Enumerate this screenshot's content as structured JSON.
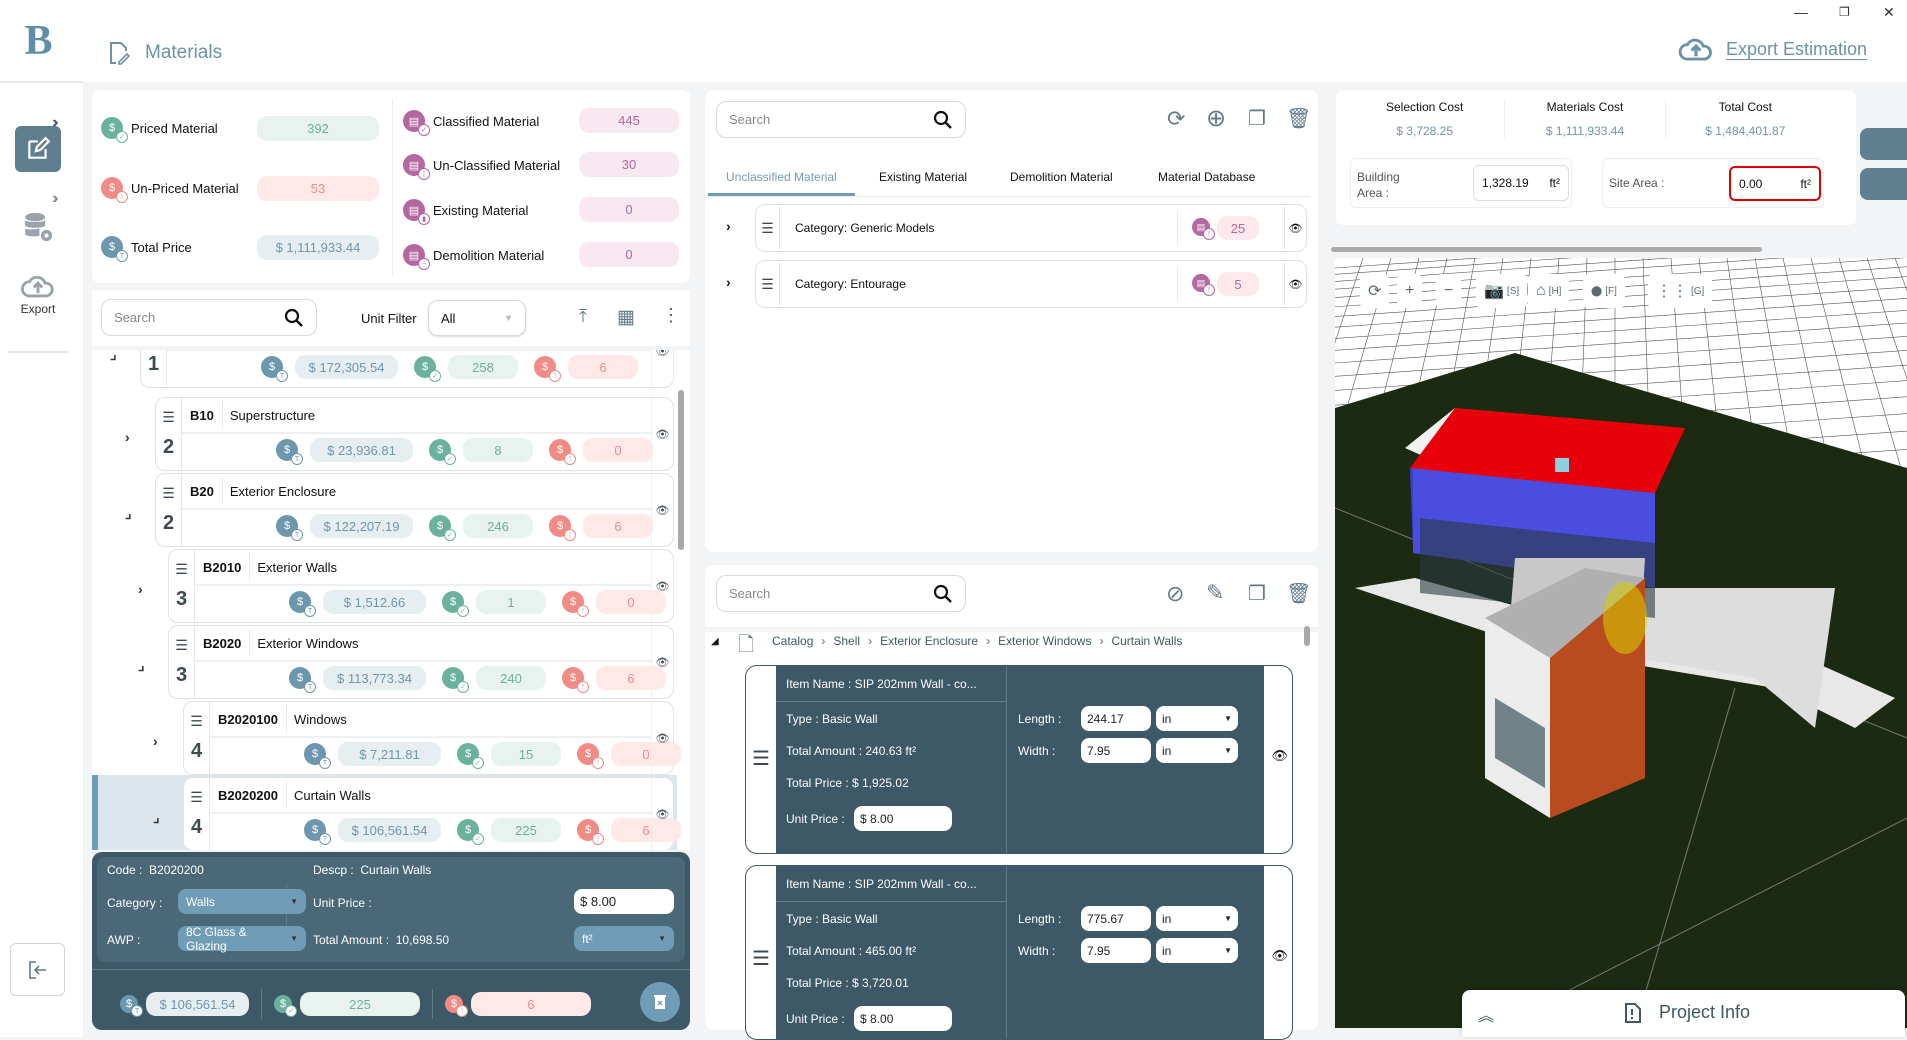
{
  "app": {
    "title": "Materials"
  },
  "window_controls": {
    "minimize": "—",
    "maximize": "❐",
    "close": "✕"
  },
  "sidebar": {
    "logo": "B",
    "items": [
      {
        "name": "materials",
        "icon": "edit-icon",
        "active": true
      },
      {
        "name": "database-settings",
        "icon": "database-gear-icon",
        "active": false
      },
      {
        "name": "export",
        "icon": "cloud-upload-icon",
        "label": "Export"
      }
    ],
    "logout_icon": "logout-icon"
  },
  "header": {
    "export_label": "Export Estimation"
  },
  "stats": {
    "priced": {
      "label": "Priced Material",
      "value": "392"
    },
    "unpriced": {
      "label": "Un-Priced Material",
      "value": "53"
    },
    "total": {
      "label": "Total Price",
      "value": "$ 1,111,933.44"
    },
    "classified": {
      "label": "Classified Material",
      "value": "445"
    },
    "unclassified": {
      "label": "Un-Classified Material",
      "value": "30"
    },
    "existing": {
      "label": "Existing Material",
      "value": "0"
    },
    "demolition": {
      "label": "Demolition Material",
      "value": "0"
    }
  },
  "filter": {
    "search_placeholder": "Search",
    "unit_filter_label": "Unit Filter",
    "unit_filter_value": "All"
  },
  "tree": {
    "rows": [
      {
        "level": "1",
        "code": "",
        "desc": "",
        "total": "$ 172,305.54",
        "priced": "258",
        "unpriced": "6",
        "expanded": true,
        "selected": false
      },
      {
        "level": "2",
        "code": "B10",
        "desc": "Superstructure",
        "total": "$ 23,936.81",
        "priced": "8",
        "unpriced": "0",
        "expanded": false,
        "selected": false
      },
      {
        "level": "2",
        "code": "B20",
        "desc": "Exterior Enclosure",
        "total": "$ 122,207.19",
        "priced": "246",
        "unpriced": "6",
        "expanded": true,
        "selected": false
      },
      {
        "level": "3",
        "code": "B2010",
        "desc": "Exterior Walls",
        "total": "$ 1,512.66",
        "priced": "1",
        "unpriced": "0",
        "expanded": false,
        "selected": false
      },
      {
        "level": "3",
        "code": "B2020",
        "desc": "Exterior Windows",
        "total": "$ 113,773.34",
        "priced": "240",
        "unpriced": "6",
        "expanded": true,
        "selected": false
      },
      {
        "level": "4",
        "code": "B2020100",
        "desc": "Windows",
        "total": "$ 7,211.81",
        "priced": "15",
        "unpriced": "0",
        "expanded": false,
        "selected": false
      },
      {
        "level": "4",
        "code": "B2020200",
        "desc": "Curtain Walls",
        "total": "$ 106,561.54",
        "priced": "225",
        "unpriced": "6",
        "expanded": true,
        "selected": true
      }
    ]
  },
  "detail": {
    "code_label": "Code :",
    "code": "B2020200",
    "descp_label": "Descp :",
    "descp": "Curtain Walls",
    "category_label": "Category :",
    "category": "Walls",
    "awp_label": "AWP :",
    "awp": "8C  Glass & Glazing",
    "unit_price_label": "Unit Price :",
    "unit_price": "$ 8.00",
    "total_amount_label": "Total Amount :",
    "total_amount": "10,698.50",
    "unit": "ft²",
    "total": "$ 106,561.54",
    "priced": "225",
    "unpriced": "6"
  },
  "middle": {
    "search_placeholder": "Search",
    "tabs": [
      "Unclassified Material",
      "Existing Material",
      "Demolition Material",
      "Material Database"
    ],
    "active_tab": 0,
    "categories": [
      {
        "label": "Category:  Generic Models",
        "count": "25"
      },
      {
        "label": "Category:  Entourage",
        "count": "5"
      }
    ],
    "bottom_search_placeholder": "Search",
    "breadcrumb": [
      "Catalog",
      "Shell",
      "Exterior Enclosure",
      "Exterior Windows",
      "Curtain Walls"
    ],
    "items": [
      {
        "name": "Item Name : SIP 202mm Wall - co...",
        "type": "Type :  Basic Wall",
        "total_amount": "Total Amount :  240.63 ft²",
        "total_price": "Total Price : $ 1,925.02",
        "unit_price_label": "Unit Price :",
        "unit_price": "$ 8.00",
        "length_label": "Length :",
        "length": "244.17",
        "length_unit": "in",
        "width_label": "Width :",
        "width": "7.95",
        "width_unit": "in"
      },
      {
        "name": "Item Name : SIP 202mm Wall - co...",
        "type": "Type :  Basic Wall",
        "total_amount": "Total Amount :  465.00 ft²",
        "total_price": "Total Price : $ 3,720.01",
        "unit_price_label": "Unit Price :",
        "unit_price": "$ 8.00",
        "length_label": "Length :",
        "length": "775.67",
        "length_unit": "in",
        "width_label": "Width :",
        "width": "7.95",
        "width_unit": "in"
      }
    ]
  },
  "costs": {
    "selection": {
      "label": "Selection Cost",
      "value": "$ 3,728.25"
    },
    "materials": {
      "label": "Materials Cost",
      "value": "$ 1,111,933.44"
    },
    "total": {
      "label": "Total Cost",
      "value": "$ 1,484,401.87"
    },
    "building_area_label": "Building Area :",
    "building_area": "1,328.19",
    "building_area_unit": "ft²",
    "site_area_label": "Site Area :",
    "site_area": "0.00",
    "site_area_unit": "ft²"
  },
  "viewer": {
    "toolbar": [
      {
        "icon": "refresh-icon",
        "glyph": "⟳",
        "key": ""
      },
      {
        "icon": "zoom-in-icon",
        "glyph": "+",
        "key": ""
      },
      {
        "icon": "zoom-out-icon",
        "glyph": "−",
        "key": ""
      },
      {
        "icon": "camera-icon",
        "glyph": "📷",
        "key": "[S]"
      },
      {
        "icon": "home-icon",
        "glyph": "⌂",
        "key": "[H]"
      },
      {
        "icon": "location-pin-icon",
        "glyph": "⬤",
        "key": "[F]"
      },
      {
        "icon": "grid-icon",
        "glyph": "⋮⋮",
        "key": "[G]"
      }
    ],
    "colors": {
      "roof": "#e8000a",
      "walls": "#4a4ee0",
      "ground": "#1d2a12"
    }
  },
  "project_info": {
    "label": "Project Info"
  }
}
